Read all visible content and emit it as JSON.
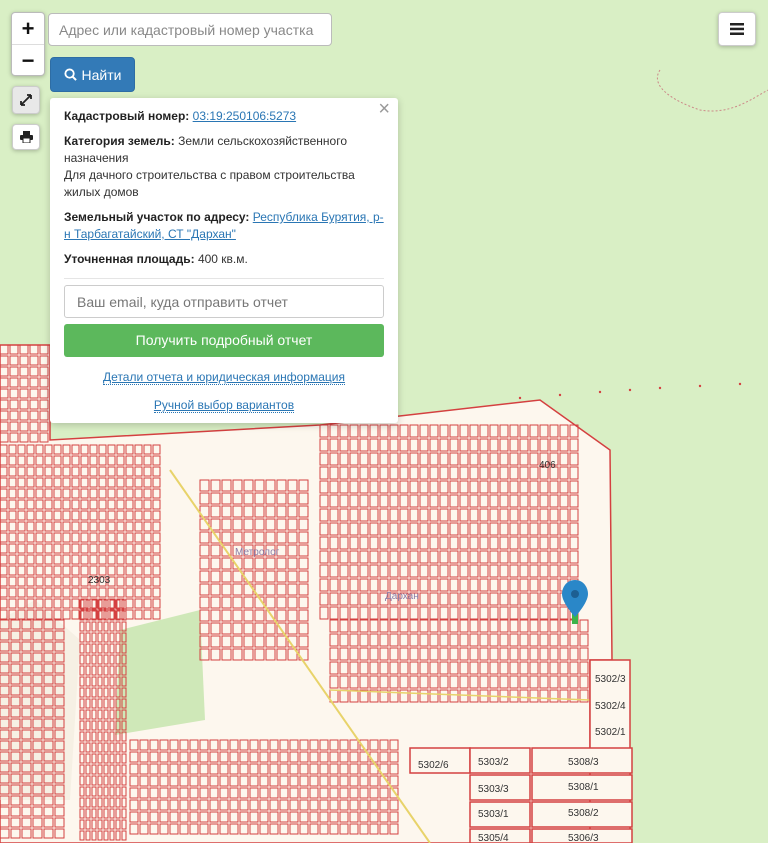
{
  "search": {
    "placeholder": "Адрес или кадастровый номер участка",
    "button_label": "Найти"
  },
  "zoom": {
    "in_label": "+",
    "out_label": "−"
  },
  "icons": {
    "menu": "hamburger-icon",
    "fullscreen": "expand-icon",
    "print": "printer-icon",
    "search": "magnifier-icon",
    "marker": "map-pin-icon",
    "close": "close-icon"
  },
  "popup": {
    "close_label": "×",
    "cadastral_label": "Кадастровый номер",
    "cadastral_value": "03:19:250106:5273",
    "category_label": "Категория земель",
    "category_value": "Земли сельскохозяйственного назначения",
    "use_value": "Для дачного строительства с правом строительства жилых домов",
    "address_label": "Земельный участок по адресу",
    "address_value": "Республика Бурятия, р-н Тарбагатайский, СТ \"Дархан\"",
    "area_label": "Уточненная площадь",
    "area_value": "400 кв.м.",
    "email_placeholder": "Ваш email, куда отправить отчет",
    "report_button": "Получить подробный отчет",
    "details_link": "Детали отчета и юридическая информация",
    "manual_link": "Ручной выбор вариантов"
  },
  "map_labels": {
    "settlement_1": "Метролог",
    "settlement_2": "Дархан",
    "parcel_406": "406",
    "parcel_2303": "2303",
    "blocks": [
      "5302/3",
      "5302/4",
      "5302/1",
      "5302/6",
      "5303/2",
      "5308/3",
      "5303/3",
      "5308/1",
      "5303/1",
      "5308/2",
      "5305/4",
      "5306/3"
    ]
  },
  "colors": {
    "land": "#d9efc5",
    "developed": "#fdf7ee",
    "parcel_line": "#d44040",
    "road": "#e8d36a",
    "marker": "#2a87c8",
    "primary": "#337ab7",
    "success": "#5cb85c"
  }
}
